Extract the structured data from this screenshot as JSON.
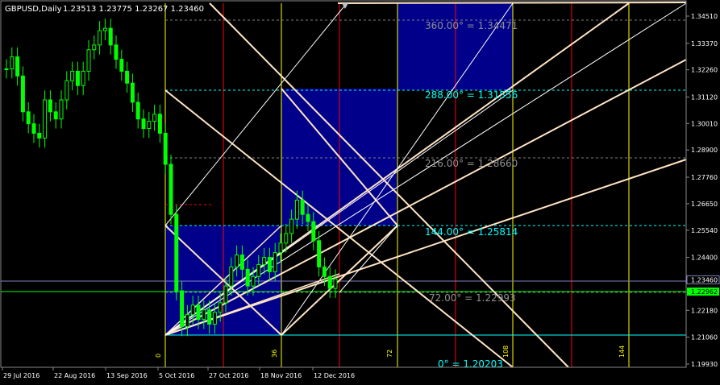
{
  "header": {
    "symbol": "GBPUSD,Daily",
    "ohlc": "1.23513 1.23775 1.23267 1.23460"
  },
  "colors": {
    "background": "#000000",
    "candle": "#00ff00",
    "grid_box": "#00008b",
    "fib_red": "#ff0000",
    "fib_yellow": "#ffff00",
    "fan_line": "#ffe4c4",
    "white_line": "#ffffff",
    "level_cyan": "#00ffff",
    "level_gray": "#808080",
    "current_price": "#00ff00",
    "axis_text": "#ffffff"
  },
  "price_axis": {
    "ticks": [
      "1.34510",
      "1.33370",
      "1.32260",
      "1.31120",
      "1.30010",
      "1.28900",
      "1.27760",
      "1.26650",
      "1.25540",
      "1.24400",
      "1.23460",
      "1.22180",
      "1.21060",
      "1.19930"
    ],
    "current_price": "1.23460",
    "current_price_alt": "1.22962"
  },
  "time_axis": {
    "ticks": [
      "29 Jul 2016",
      "22 Aug 2016",
      "13 Sep 2016",
      "5 Oct 2016",
      "27 Oct 2016",
      "18 Nov 2016",
      "12 Dec 2016"
    ]
  },
  "gann_levels": [
    {
      "label": "360.00° = 1.34471",
      "color": "gray"
    },
    {
      "label": "288.00° = 1.31556",
      "color": "cyan"
    },
    {
      "label": "216.00° = 1.28660",
      "color": "gray"
    },
    {
      "label": "144.00° = 1.25814",
      "color": "cyan"
    },
    {
      "label": "72.00° = 1.22993",
      "color": "gray"
    },
    {
      "label": "0° = 1.20203",
      "color": "cyan"
    }
  ],
  "time_markers": [
    "0",
    "36",
    "72",
    "108",
    "144"
  ],
  "chart_data": {
    "type": "candlestick",
    "title": "GBPUSD,Daily",
    "ylim": [
      1.1993,
      1.3483
    ],
    "x": [
      "29 Jul 2016",
      "22 Aug 2016",
      "13 Sep 2016",
      "5 Oct 2016",
      "27 Oct 2016",
      "18 Nov 2016",
      "12 Dec 2016"
    ],
    "series": [
      {
        "close": [
          1.323,
          1.328,
          1.32,
          1.305,
          1.3,
          1.296,
          1.294,
          1.31,
          1.305,
          1.302,
          1.31,
          1.318,
          1.322,
          1.316,
          1.322,
          1.331,
          1.333,
          1.339,
          1.34,
          1.333,
          1.327,
          1.322,
          1.317,
          1.309,
          1.302,
          1.298,
          1.301,
          1.304,
          1.296,
          1.283,
          1.262,
          1.23,
          1.215,
          1.22,
          1.224,
          1.218,
          1.222,
          1.216,
          1.221,
          1.225,
          1.232,
          1.24,
          1.245,
          1.239,
          1.232,
          1.236,
          1.241,
          1.244,
          1.238,
          1.246,
          1.25,
          1.254,
          1.26,
          1.268,
          1.262,
          1.259,
          1.251,
          1.24,
          1.236,
          1.231,
          1.235
        ]
      }
    ]
  }
}
